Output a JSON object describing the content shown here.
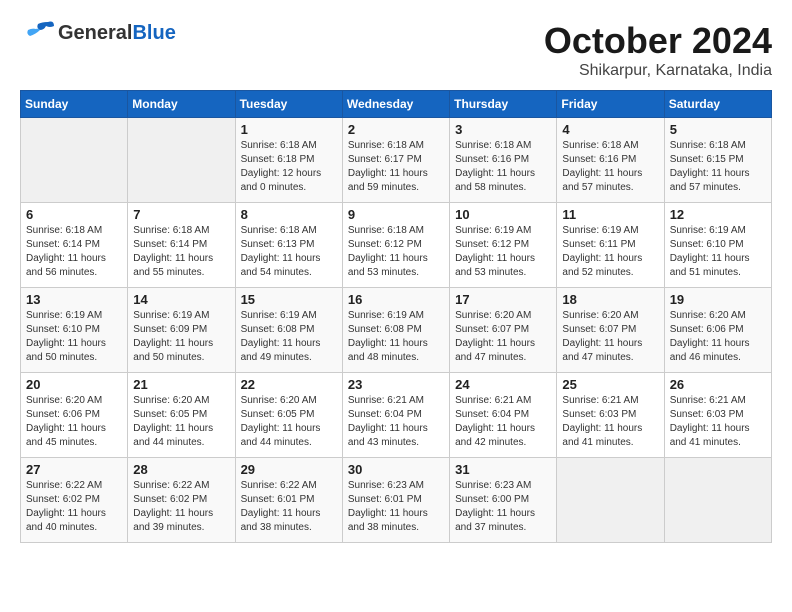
{
  "logo": {
    "general": "General",
    "blue": "Blue"
  },
  "title": "October 2024",
  "subtitle": "Shikarpur, Karnataka, India",
  "weekdays": [
    "Sunday",
    "Monday",
    "Tuesday",
    "Wednesday",
    "Thursday",
    "Friday",
    "Saturday"
  ],
  "weeks": [
    [
      {
        "day": "",
        "info": ""
      },
      {
        "day": "",
        "info": ""
      },
      {
        "day": "1",
        "info": "Sunrise: 6:18 AM\nSunset: 6:18 PM\nDaylight: 12 hours\nand 0 minutes."
      },
      {
        "day": "2",
        "info": "Sunrise: 6:18 AM\nSunset: 6:17 PM\nDaylight: 11 hours\nand 59 minutes."
      },
      {
        "day": "3",
        "info": "Sunrise: 6:18 AM\nSunset: 6:16 PM\nDaylight: 11 hours\nand 58 minutes."
      },
      {
        "day": "4",
        "info": "Sunrise: 6:18 AM\nSunset: 6:16 PM\nDaylight: 11 hours\nand 57 minutes."
      },
      {
        "day": "5",
        "info": "Sunrise: 6:18 AM\nSunset: 6:15 PM\nDaylight: 11 hours\nand 57 minutes."
      }
    ],
    [
      {
        "day": "6",
        "info": "Sunrise: 6:18 AM\nSunset: 6:14 PM\nDaylight: 11 hours\nand 56 minutes."
      },
      {
        "day": "7",
        "info": "Sunrise: 6:18 AM\nSunset: 6:14 PM\nDaylight: 11 hours\nand 55 minutes."
      },
      {
        "day": "8",
        "info": "Sunrise: 6:18 AM\nSunset: 6:13 PM\nDaylight: 11 hours\nand 54 minutes."
      },
      {
        "day": "9",
        "info": "Sunrise: 6:18 AM\nSunset: 6:12 PM\nDaylight: 11 hours\nand 53 minutes."
      },
      {
        "day": "10",
        "info": "Sunrise: 6:19 AM\nSunset: 6:12 PM\nDaylight: 11 hours\nand 53 minutes."
      },
      {
        "day": "11",
        "info": "Sunrise: 6:19 AM\nSunset: 6:11 PM\nDaylight: 11 hours\nand 52 minutes."
      },
      {
        "day": "12",
        "info": "Sunrise: 6:19 AM\nSunset: 6:10 PM\nDaylight: 11 hours\nand 51 minutes."
      }
    ],
    [
      {
        "day": "13",
        "info": "Sunrise: 6:19 AM\nSunset: 6:10 PM\nDaylight: 11 hours\nand 50 minutes."
      },
      {
        "day": "14",
        "info": "Sunrise: 6:19 AM\nSunset: 6:09 PM\nDaylight: 11 hours\nand 50 minutes."
      },
      {
        "day": "15",
        "info": "Sunrise: 6:19 AM\nSunset: 6:08 PM\nDaylight: 11 hours\nand 49 minutes."
      },
      {
        "day": "16",
        "info": "Sunrise: 6:19 AM\nSunset: 6:08 PM\nDaylight: 11 hours\nand 48 minutes."
      },
      {
        "day": "17",
        "info": "Sunrise: 6:20 AM\nSunset: 6:07 PM\nDaylight: 11 hours\nand 47 minutes."
      },
      {
        "day": "18",
        "info": "Sunrise: 6:20 AM\nSunset: 6:07 PM\nDaylight: 11 hours\nand 47 minutes."
      },
      {
        "day": "19",
        "info": "Sunrise: 6:20 AM\nSunset: 6:06 PM\nDaylight: 11 hours\nand 46 minutes."
      }
    ],
    [
      {
        "day": "20",
        "info": "Sunrise: 6:20 AM\nSunset: 6:06 PM\nDaylight: 11 hours\nand 45 minutes."
      },
      {
        "day": "21",
        "info": "Sunrise: 6:20 AM\nSunset: 6:05 PM\nDaylight: 11 hours\nand 44 minutes."
      },
      {
        "day": "22",
        "info": "Sunrise: 6:20 AM\nSunset: 6:05 PM\nDaylight: 11 hours\nand 44 minutes."
      },
      {
        "day": "23",
        "info": "Sunrise: 6:21 AM\nSunset: 6:04 PM\nDaylight: 11 hours\nand 43 minutes."
      },
      {
        "day": "24",
        "info": "Sunrise: 6:21 AM\nSunset: 6:04 PM\nDaylight: 11 hours\nand 42 minutes."
      },
      {
        "day": "25",
        "info": "Sunrise: 6:21 AM\nSunset: 6:03 PM\nDaylight: 11 hours\nand 41 minutes."
      },
      {
        "day": "26",
        "info": "Sunrise: 6:21 AM\nSunset: 6:03 PM\nDaylight: 11 hours\nand 41 minutes."
      }
    ],
    [
      {
        "day": "27",
        "info": "Sunrise: 6:22 AM\nSunset: 6:02 PM\nDaylight: 11 hours\nand 40 minutes."
      },
      {
        "day": "28",
        "info": "Sunrise: 6:22 AM\nSunset: 6:02 PM\nDaylight: 11 hours\nand 39 minutes."
      },
      {
        "day": "29",
        "info": "Sunrise: 6:22 AM\nSunset: 6:01 PM\nDaylight: 11 hours\nand 38 minutes."
      },
      {
        "day": "30",
        "info": "Sunrise: 6:23 AM\nSunset: 6:01 PM\nDaylight: 11 hours\nand 38 minutes."
      },
      {
        "day": "31",
        "info": "Sunrise: 6:23 AM\nSunset: 6:00 PM\nDaylight: 11 hours\nand 37 minutes."
      },
      {
        "day": "",
        "info": ""
      },
      {
        "day": "",
        "info": ""
      }
    ]
  ]
}
